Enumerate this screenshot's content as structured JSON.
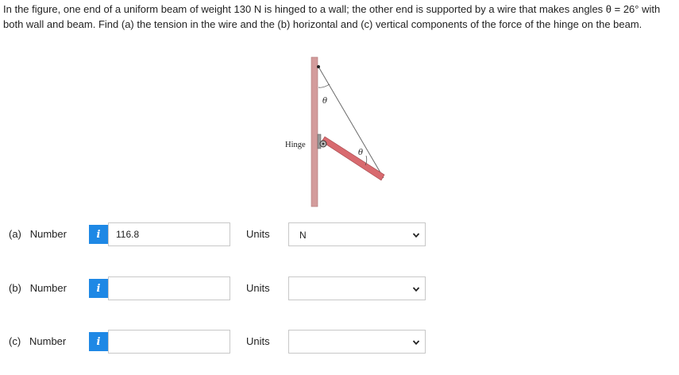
{
  "problem": {
    "text": "In the figure, one end of a uniform beam of weight 130 N is hinged to a wall; the other end is supported by a wire that makes angles θ = 26° with both wall and beam. Find (a) the tension in the wire and the (b) horizontal and (c) vertical components of the force of the hinge on the beam."
  },
  "figure": {
    "hinge_label": "Hinge",
    "theta_top": "θ",
    "theta_bottom": "θ",
    "colors": {
      "wall": "#d39c9c",
      "beam": "#d86a6f",
      "wire": "#6a6a6a"
    }
  },
  "rows": [
    {
      "label": "(a)   Number",
      "info": "i",
      "value": "116.8",
      "units_label": "Units",
      "units_value": "N"
    },
    {
      "label": "(b)   Number",
      "info": "i",
      "value": "",
      "units_label": "Units",
      "units_value": ""
    },
    {
      "label": "(c)   Number",
      "info": "i",
      "value": "",
      "units_label": "Units",
      "units_value": ""
    }
  ],
  "accent_color": "#1e88e5"
}
